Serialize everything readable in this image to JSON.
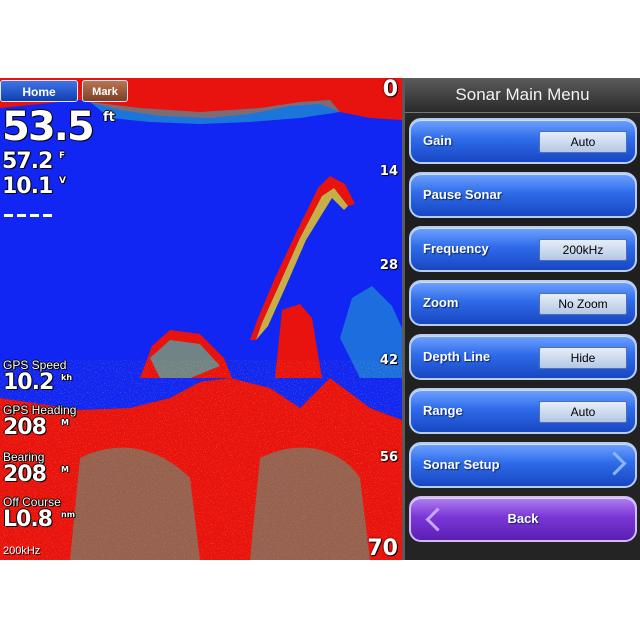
{
  "sonar": {
    "buttons": {
      "home": "Home",
      "mark": "Mark"
    },
    "depth_scale": [
      "0",
      "14",
      "28",
      "42",
      "56",
      "70"
    ],
    "depth": {
      "value": "53.5",
      "unit": "ft"
    },
    "water_temp": {
      "value": "57.2",
      "unit": "F"
    },
    "voltage": {
      "value": "10.1",
      "unit": "V"
    },
    "data_fields": [
      {
        "label": "GPS Speed",
        "value": "10.2",
        "unit": "kh"
      },
      {
        "label": "GPS Heading",
        "value": "208",
        "unit": "M"
      },
      {
        "label": "Bearing",
        "value": "208",
        "unit": "M"
      },
      {
        "label": "Off Course",
        "value": "L0.8",
        "unit": "nm"
      }
    ],
    "frequency_label": "200kHz",
    "colors": {
      "water": "#1126f2",
      "bottom": "#e8120e"
    }
  },
  "menu": {
    "title": "Sonar Main Menu",
    "items": [
      {
        "label": "Gain",
        "value": "Auto"
      },
      {
        "label": "Pause Sonar"
      },
      {
        "label": "Frequency",
        "value": "200kHz"
      },
      {
        "label": "Zoom",
        "value": "No Zoom"
      },
      {
        "label": "Depth Line",
        "value": "Hide"
      },
      {
        "label": "Range",
        "value": "Auto"
      },
      {
        "label": "Sonar Setup",
        "icon": "chevron-right-icon"
      },
      {
        "label": "Back",
        "icon": "chevron-left-icon"
      }
    ],
    "colors": {
      "item": "#2f6bea",
      "back": "#7a37d6"
    }
  }
}
